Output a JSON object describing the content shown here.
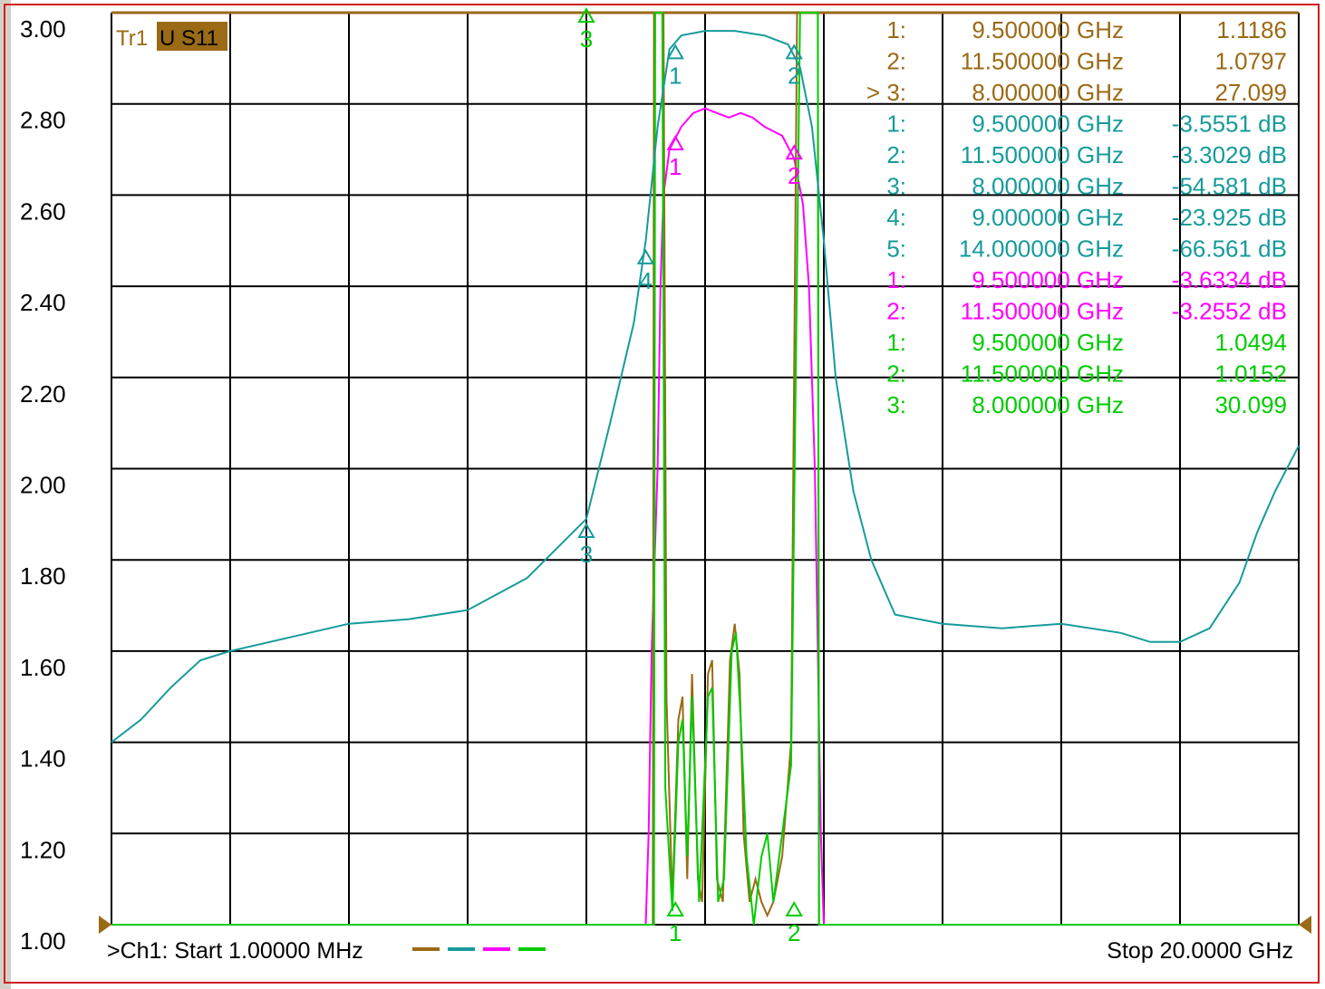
{
  "chart_data": {
    "type": "line",
    "trace_label": "Tr1",
    "measurement": "U S11",
    "ylim": [
      1.0,
      3.0
    ],
    "yticks": [
      "3.00",
      "2.80",
      "2.60",
      "2.40",
      "2.20",
      "2.00",
      "1.80",
      "1.60",
      "1.40",
      "1.20",
      "1.00"
    ],
    "x_start_label": ">Ch1: Start  1.00000 MHz",
    "x_stop_label": "Stop  20.0000 GHz",
    "xlim_ghz": [
      0.001,
      20.0
    ],
    "x_divisions": 10,
    "grid": true,
    "colors": {
      "grid": "#000000",
      "trace1": "#9b6a15",
      "trace2": "#179b9b",
      "trace3": "#ff00ff",
      "trace4": "#00cc00"
    },
    "series": [
      {
        "color": "#9b6a15",
        "points": [
          [
            0,
            1.0
          ],
          [
            9.12,
            1.0
          ],
          [
            9.14,
            3.0
          ],
          [
            9.3,
            3.0
          ],
          [
            9.35,
            1.5
          ],
          [
            9.45,
            1.05
          ],
          [
            9.55,
            1.45
          ],
          [
            9.62,
            1.5
          ],
          [
            9.7,
            1.1
          ],
          [
            9.78,
            1.55
          ],
          [
            9.88,
            1.1
          ],
          [
            9.95,
            1.05
          ],
          [
            10.05,
            1.55
          ],
          [
            10.12,
            1.58
          ],
          [
            10.2,
            1.1
          ],
          [
            10.3,
            1.05
          ],
          [
            10.42,
            1.58
          ],
          [
            10.5,
            1.66
          ],
          [
            10.58,
            1.55
          ],
          [
            10.65,
            1.2
          ],
          [
            10.75,
            1.05
          ],
          [
            10.85,
            1.1
          ],
          [
            10.95,
            1.05
          ],
          [
            11.05,
            1.02
          ],
          [
            11.15,
            1.05
          ],
          [
            11.3,
            1.15
          ],
          [
            11.45,
            1.4
          ],
          [
            11.55,
            3.0
          ],
          [
            11.9,
            3.0
          ],
          [
            11.92,
            1.0
          ],
          [
            20,
            1.0
          ]
        ]
      },
      {
        "color": "#179b9b",
        "points": [
          [
            0,
            1.4
          ],
          [
            0.5,
            1.45
          ],
          [
            1.0,
            1.52
          ],
          [
            1.5,
            1.58
          ],
          [
            2.0,
            1.6
          ],
          [
            3.0,
            1.63
          ],
          [
            4.0,
            1.66
          ],
          [
            5.0,
            1.67
          ],
          [
            6.0,
            1.69
          ],
          [
            7.0,
            1.76
          ],
          [
            8.0,
            1.89
          ],
          [
            8.4,
            2.1
          ],
          [
            8.8,
            2.32
          ],
          [
            9.0,
            2.5
          ],
          [
            9.2,
            2.75
          ],
          [
            9.4,
            2.92
          ],
          [
            9.6,
            2.95
          ],
          [
            10.0,
            2.96
          ],
          [
            10.5,
            2.96
          ],
          [
            11.0,
            2.95
          ],
          [
            11.4,
            2.93
          ],
          [
            11.6,
            2.88
          ],
          [
            11.8,
            2.75
          ],
          [
            12.0,
            2.5
          ],
          [
            12.2,
            2.2
          ],
          [
            12.5,
            1.95
          ],
          [
            12.8,
            1.8
          ],
          [
            13.2,
            1.68
          ],
          [
            14.0,
            1.66
          ],
          [
            15.0,
            1.65
          ],
          [
            16.0,
            1.66
          ],
          [
            17.0,
            1.64
          ],
          [
            17.5,
            1.62
          ],
          [
            18.0,
            1.62
          ],
          [
            18.5,
            1.65
          ],
          [
            19.0,
            1.75
          ],
          [
            19.3,
            1.86
          ],
          [
            19.6,
            1.95
          ],
          [
            20.0,
            2.05
          ]
        ]
      },
      {
        "color": "#ff00ff",
        "points": [
          [
            0,
            1.0
          ],
          [
            9.0,
            1.0
          ],
          [
            9.05,
            1.2
          ],
          [
            9.1,
            1.6
          ],
          [
            9.2,
            2.0
          ],
          [
            9.25,
            2.4
          ],
          [
            9.3,
            2.6
          ],
          [
            9.4,
            2.7
          ],
          [
            9.6,
            2.75
          ],
          [
            9.8,
            2.78
          ],
          [
            10.0,
            2.79
          ],
          [
            10.2,
            2.78
          ],
          [
            10.4,
            2.77
          ],
          [
            10.6,
            2.78
          ],
          [
            10.8,
            2.77
          ],
          [
            11.0,
            2.75
          ],
          [
            11.3,
            2.73
          ],
          [
            11.5,
            2.68
          ],
          [
            11.65,
            2.58
          ],
          [
            11.75,
            2.4
          ],
          [
            11.85,
            2.0
          ],
          [
            11.9,
            1.6
          ],
          [
            11.95,
            1.2
          ],
          [
            12.0,
            1.0
          ],
          [
            20,
            1.0
          ]
        ]
      },
      {
        "color": "#00cc00",
        "points": [
          [
            0,
            1.0
          ],
          [
            9.14,
            1.0
          ],
          [
            9.16,
            3.0
          ],
          [
            9.28,
            3.0
          ],
          [
            9.33,
            1.3
          ],
          [
            9.45,
            1.03
          ],
          [
            9.55,
            1.4
          ],
          [
            9.62,
            1.45
          ],
          [
            9.7,
            1.15
          ],
          [
            9.78,
            1.5
          ],
          [
            9.9,
            1.05
          ],
          [
            10.05,
            1.5
          ],
          [
            10.12,
            1.52
          ],
          [
            10.22,
            1.05
          ],
          [
            10.32,
            1.1
          ],
          [
            10.45,
            1.6
          ],
          [
            10.52,
            1.64
          ],
          [
            10.6,
            1.45
          ],
          [
            10.7,
            1.15
          ],
          [
            10.82,
            1.0
          ],
          [
            10.95,
            1.15
          ],
          [
            11.05,
            1.2
          ],
          [
            11.15,
            1.05
          ],
          [
            11.3,
            1.2
          ],
          [
            11.45,
            1.35
          ],
          [
            11.6,
            3.0
          ],
          [
            11.9,
            3.0
          ],
          [
            11.92,
            1.0
          ],
          [
            20,
            1.0
          ]
        ]
      }
    ],
    "markers": [
      {
        "row": "1:",
        "freq": "9.500000 GHz",
        "value": "1.1186",
        "color": "#9b6a15"
      },
      {
        "row": "2:",
        "freq": "11.500000 GHz",
        "value": "1.0797",
        "color": "#9b6a15"
      },
      {
        "row": "> 3:",
        "freq": "8.000000 GHz",
        "value": "27.099",
        "color": "#9b6a15"
      },
      {
        "row": "1:",
        "freq": "9.500000 GHz",
        "value": "-3.5551 dB",
        "color": "#179b9b"
      },
      {
        "row": "2:",
        "freq": "11.500000 GHz",
        "value": "-3.3029 dB",
        "color": "#179b9b"
      },
      {
        "row": "3:",
        "freq": "8.000000 GHz",
        "value": "-54.581 dB",
        "color": "#179b9b"
      },
      {
        "row": "4:",
        "freq": "9.000000 GHz",
        "value": "-23.925 dB",
        "color": "#179b9b"
      },
      {
        "row": "5:",
        "freq": "14.000000 GHz",
        "value": "-66.561 dB",
        "color": "#179b9b"
      },
      {
        "row": "1:",
        "freq": "9.500000 GHz",
        "value": "-3.6334 dB",
        "color": "#ff00ff"
      },
      {
        "row": "2:",
        "freq": "11.500000 GHz",
        "value": "-3.2552 dB",
        "color": "#ff00ff"
      },
      {
        "row": "1:",
        "freq": "9.500000 GHz",
        "value": "1.0494",
        "color": "#00cc00"
      },
      {
        "row": "2:",
        "freq": "11.500000 GHz",
        "value": "1.0152",
        "color": "#00cc00"
      },
      {
        "row": "3:",
        "freq": "8.000000 GHz",
        "value": "30.099",
        "color": "#00cc00"
      }
    ],
    "trace_markers": [
      {
        "label": "1",
        "color": "#179b9b",
        "x": 9.5,
        "y": 2.9
      },
      {
        "label": "2",
        "color": "#179b9b",
        "x": 11.5,
        "y": 2.9
      },
      {
        "label": "4",
        "color": "#179b9b",
        "x": 9.0,
        "y": 2.45
      },
      {
        "label": "3",
        "color": "#179b9b",
        "x": 8.0,
        "y": 1.85
      },
      {
        "label": "1",
        "color": "#ff00ff",
        "x": 9.5,
        "y": 2.7
      },
      {
        "label": "2",
        "color": "#ff00ff",
        "x": 11.5,
        "y": 2.68
      },
      {
        "label": "3",
        "color": "#00cc00",
        "x": 8.0,
        "y": 2.98
      },
      {
        "label": "1",
        "color": "#00cc00",
        "x": 9.5,
        "y": 1.02
      },
      {
        "label": "2",
        "color": "#00cc00",
        "x": 11.5,
        "y": 1.02
      }
    ]
  }
}
